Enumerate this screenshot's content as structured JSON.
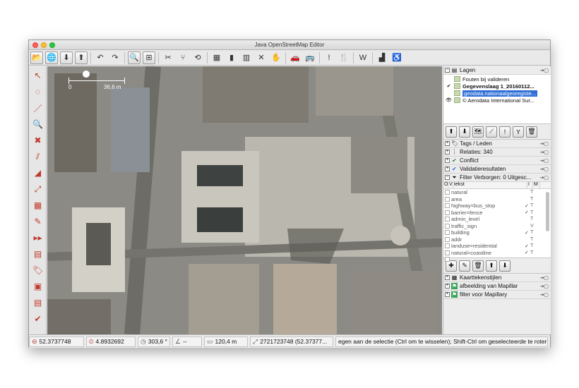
{
  "window": {
    "title": "Java OpenStreetMap Editor"
  },
  "toolbar": {
    "buttons": [
      {
        "name": "open-file-icon",
        "glyph": "📂",
        "framed": true
      },
      {
        "name": "open-location-icon",
        "glyph": "🌐",
        "framed": true
      },
      {
        "name": "save-icon",
        "glyph": "⬇",
        "framed": true
      },
      {
        "name": "upload-icon",
        "glyph": "⬆",
        "framed": true
      },
      {
        "sep": true
      },
      {
        "name": "undo-icon",
        "glyph": "↶"
      },
      {
        "name": "redo-icon",
        "glyph": "↷"
      },
      {
        "sep": true
      },
      {
        "name": "preferences-icon",
        "glyph": "🔍",
        "framed": true
      },
      {
        "name": "zoom-fit-icon",
        "glyph": "⊞",
        "framed": true
      },
      {
        "sep": true
      },
      {
        "name": "split-way-icon",
        "glyph": "✂"
      },
      {
        "name": "combine-way-icon",
        "glyph": "⑂"
      },
      {
        "name": "reverse-way-icon",
        "glyph": "⟲"
      },
      {
        "sep": true
      },
      {
        "name": "align-icon",
        "glyph": "▦"
      },
      {
        "name": "building-icon",
        "glyph": "▮"
      },
      {
        "name": "railway-icon",
        "glyph": "▥"
      },
      {
        "name": "hiking-icon",
        "glyph": "✕"
      },
      {
        "name": "hand-icon",
        "glyph": "✋"
      },
      {
        "sep": true
      },
      {
        "name": "car-icon",
        "glyph": "🚗"
      },
      {
        "name": "bus-icon",
        "glyph": "🚌"
      },
      {
        "sep": true
      },
      {
        "name": "warning-icon",
        "glyph": "!"
      },
      {
        "name": "restaurant-icon",
        "glyph": "🍴"
      },
      {
        "sep": true
      },
      {
        "name": "shop-icon",
        "glyph": "W"
      },
      {
        "sep": true
      },
      {
        "name": "factory-icon",
        "glyph": "▟"
      },
      {
        "name": "accessibility-icon",
        "glyph": "♿"
      }
    ]
  },
  "left_tools": [
    {
      "name": "select-tool-icon",
      "glyph": "↖"
    },
    {
      "name": "lasso-tool-icon",
      "glyph": "◌"
    },
    {
      "name": "draw-tool-icon",
      "glyph": "／"
    },
    {
      "name": "zoom-tool-icon",
      "glyph": "🔍"
    },
    {
      "name": "delete-tool-icon",
      "glyph": "✖"
    },
    {
      "name": "parallel-tool-icon",
      "glyph": "⫽"
    },
    {
      "name": "measure-tool-icon",
      "glyph": "◢"
    },
    {
      "name": "improve-way-icon",
      "glyph": "⤢"
    },
    {
      "name": "building-tool-icon",
      "glyph": "▦"
    },
    {
      "name": "pencil-tool-icon",
      "glyph": "✎"
    },
    {
      "name": "more-tools-icon",
      "glyph": "▸▸"
    },
    {
      "name": "layers-toggle-icon",
      "glyph": "▤"
    },
    {
      "name": "tag-toggle-icon",
      "glyph": "🏷"
    },
    {
      "name": "history-toggle-icon",
      "glyph": "▣"
    },
    {
      "name": "notes-toggle-icon",
      "glyph": "▤"
    },
    {
      "name": "validator-toggle-icon",
      "glyph": "✔"
    }
  ],
  "map": {
    "scale_left": "0",
    "scale_right": "36,6 m"
  },
  "panels": {
    "layers": {
      "title": "Lagen",
      "rows": [
        {
          "status": "",
          "label": "Fouten bij valideren",
          "bold": false,
          "selected": false
        },
        {
          "status": "✔",
          "label": "Gegevenslaag 1_20160112...",
          "bold": true,
          "selected": false
        },
        {
          "status": "",
          "label": "geodata.nationaalgeoregiste...",
          "bold": false,
          "selected": true
        },
        {
          "status": "👁",
          "label": "© Aerodata International Sur...",
          "bold": false,
          "selected": false
        }
      ]
    },
    "layer_buttons": [
      "⬆",
      "⬇",
      "🗺",
      "⟋",
      "!",
      "Y",
      "🗑"
    ],
    "tags": {
      "title": "Tags / Leden"
    },
    "relations": {
      "title": "Relaties: 340"
    },
    "conflict": {
      "title": "Conflict"
    },
    "validation": {
      "title": "Validatieresultaten"
    },
    "filter": {
      "title": "Filter Verborgen: 0 Uitgesc...",
      "columns": [
        "O",
        "V",
        "tekst",
        "I",
        "M"
      ],
      "rows": [
        {
          "text": "natural",
          "i": "",
          "m": "T"
        },
        {
          "text": "area",
          "i": "",
          "m": "T"
        },
        {
          "text": "highway=bus_stop",
          "i": "✓",
          "m": "T"
        },
        {
          "text": "barrier=fence",
          "i": "✓",
          "m": "T"
        },
        {
          "text": "admin_level",
          "i": "",
          "m": "T"
        },
        {
          "text": "traffic_sign",
          "i": "",
          "m": "V"
        },
        {
          "text": "building",
          "i": "✓",
          "m": "T"
        },
        {
          "text": "addr",
          "i": "",
          "m": "T"
        },
        {
          "text": "landuse=residential",
          "i": "✓",
          "m": "T"
        },
        {
          "text": "natural=coastline",
          "i": "✓",
          "m": "T"
        },
        {
          "text": "...",
          "i": "",
          "m": ""
        }
      ]
    },
    "filter_buttons": [
      "✚",
      "✎",
      "🗑",
      "⬆",
      "⬇"
    ],
    "mapstyles": {
      "title": "Kaarttekenstijlen"
    },
    "mapillary_image": {
      "title": "afbeelding van Mapillar"
    },
    "mapillary_filter": {
      "title": "filter voor Mapillary"
    }
  },
  "status": {
    "lat": "52.3737748",
    "lon": "4.8932692",
    "heading": "303,6 °",
    "angle": "--",
    "distance": "120,4 m",
    "object": "2721723748 (52.37377...",
    "help": "egen aan de selectie (Ctrl om te wisselen); Shift-Ctrl om geselecteerde te roter"
  }
}
